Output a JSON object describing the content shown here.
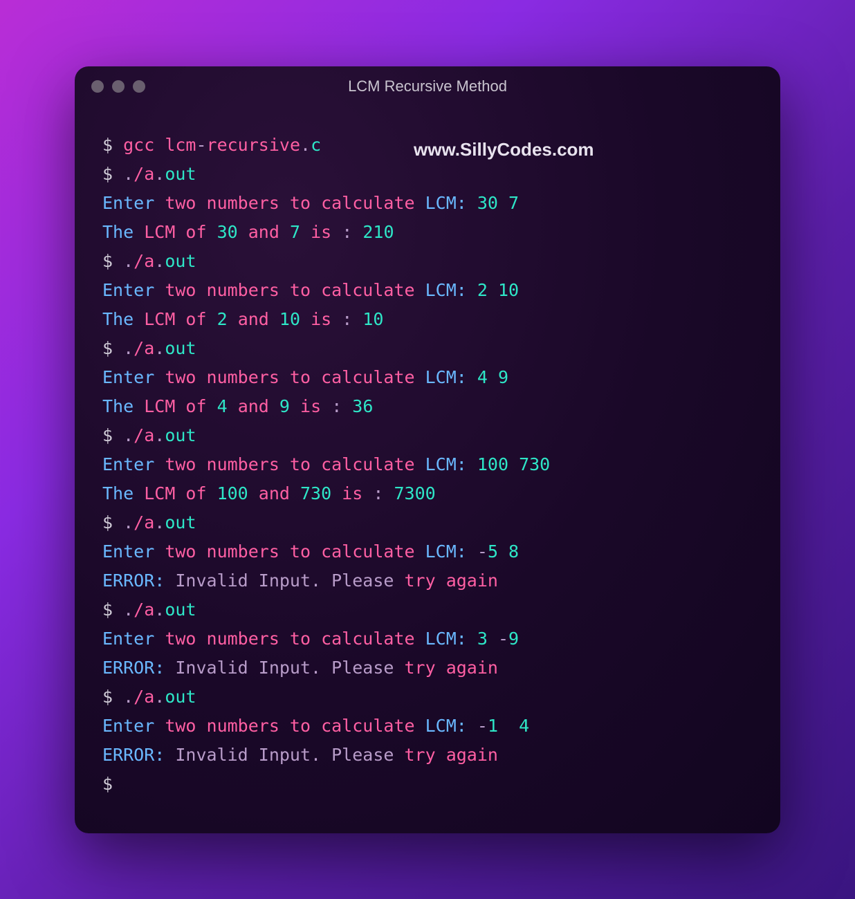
{
  "window": {
    "title": "LCM Recursive Method"
  },
  "watermark": "www.SillyCodes.com",
  "terminal": {
    "lines": [
      [
        {
          "t": "$ ",
          "c": "c-prompt"
        },
        {
          "t": "gcc lcm",
          "c": "c-pink"
        },
        {
          "t": "-",
          "c": "c-lav"
        },
        {
          "t": "recursive",
          "c": "c-pink"
        },
        {
          "t": ".",
          "c": "c-lav"
        },
        {
          "t": "c",
          "c": "c-teal"
        }
      ],
      [
        {
          "t": "$ ",
          "c": "c-prompt"
        },
        {
          "t": ".",
          "c": "c-lav"
        },
        {
          "t": "/a",
          "c": "c-pink"
        },
        {
          "t": ".",
          "c": "c-lav"
        },
        {
          "t": "out",
          "c": "c-teal"
        }
      ],
      [
        {
          "t": "Enter ",
          "c": "c-cyan"
        },
        {
          "t": "two numbers to calculate ",
          "c": "c-pink"
        },
        {
          "t": "LCM: ",
          "c": "c-cyan"
        },
        {
          "t": "30 7",
          "c": "c-teal"
        }
      ],
      [
        {
          "t": "The ",
          "c": "c-cyan"
        },
        {
          "t": "LCM of ",
          "c": "c-pink"
        },
        {
          "t": "30",
          "c": "c-teal"
        },
        {
          "t": " and ",
          "c": "c-pink"
        },
        {
          "t": "7",
          "c": "c-teal"
        },
        {
          "t": " is ",
          "c": "c-pink"
        },
        {
          "t": ": ",
          "c": "c-lav"
        },
        {
          "t": "210",
          "c": "c-teal"
        }
      ],
      [
        {
          "t": "$ ",
          "c": "c-prompt"
        },
        {
          "t": ".",
          "c": "c-lav"
        },
        {
          "t": "/a",
          "c": "c-pink"
        },
        {
          "t": ".",
          "c": "c-lav"
        },
        {
          "t": "out",
          "c": "c-teal"
        }
      ],
      [
        {
          "t": "Enter ",
          "c": "c-cyan"
        },
        {
          "t": "two numbers to calculate ",
          "c": "c-pink"
        },
        {
          "t": "LCM: ",
          "c": "c-cyan"
        },
        {
          "t": "2 10",
          "c": "c-teal"
        }
      ],
      [
        {
          "t": "The ",
          "c": "c-cyan"
        },
        {
          "t": "LCM of ",
          "c": "c-pink"
        },
        {
          "t": "2",
          "c": "c-teal"
        },
        {
          "t": " and ",
          "c": "c-pink"
        },
        {
          "t": "10",
          "c": "c-teal"
        },
        {
          "t": " is ",
          "c": "c-pink"
        },
        {
          "t": ": ",
          "c": "c-lav"
        },
        {
          "t": "10",
          "c": "c-teal"
        }
      ],
      [
        {
          "t": "$ ",
          "c": "c-prompt"
        },
        {
          "t": ".",
          "c": "c-lav"
        },
        {
          "t": "/a",
          "c": "c-pink"
        },
        {
          "t": ".",
          "c": "c-lav"
        },
        {
          "t": "out",
          "c": "c-teal"
        }
      ],
      [
        {
          "t": "Enter ",
          "c": "c-cyan"
        },
        {
          "t": "two numbers to calculate ",
          "c": "c-pink"
        },
        {
          "t": "LCM: ",
          "c": "c-cyan"
        },
        {
          "t": "4 9",
          "c": "c-teal"
        }
      ],
      [
        {
          "t": "The ",
          "c": "c-cyan"
        },
        {
          "t": "LCM of ",
          "c": "c-pink"
        },
        {
          "t": "4",
          "c": "c-teal"
        },
        {
          "t": " and ",
          "c": "c-pink"
        },
        {
          "t": "9",
          "c": "c-teal"
        },
        {
          "t": " is ",
          "c": "c-pink"
        },
        {
          "t": ": ",
          "c": "c-lav"
        },
        {
          "t": "36",
          "c": "c-teal"
        }
      ],
      [
        {
          "t": "$ ",
          "c": "c-prompt"
        },
        {
          "t": ".",
          "c": "c-lav"
        },
        {
          "t": "/a",
          "c": "c-pink"
        },
        {
          "t": ".",
          "c": "c-lav"
        },
        {
          "t": "out",
          "c": "c-teal"
        }
      ],
      [
        {
          "t": "Enter ",
          "c": "c-cyan"
        },
        {
          "t": "two numbers to calculate ",
          "c": "c-pink"
        },
        {
          "t": "LCM: ",
          "c": "c-cyan"
        },
        {
          "t": "100 730",
          "c": "c-teal"
        }
      ],
      [
        {
          "t": "The ",
          "c": "c-cyan"
        },
        {
          "t": "LCM of ",
          "c": "c-pink"
        },
        {
          "t": "100",
          "c": "c-teal"
        },
        {
          "t": " and ",
          "c": "c-pink"
        },
        {
          "t": "730",
          "c": "c-teal"
        },
        {
          "t": " is ",
          "c": "c-pink"
        },
        {
          "t": ": ",
          "c": "c-lav"
        },
        {
          "t": "7300",
          "c": "c-teal"
        }
      ],
      [
        {
          "t": "$ ",
          "c": "c-prompt"
        },
        {
          "t": ".",
          "c": "c-lav"
        },
        {
          "t": "/a",
          "c": "c-pink"
        },
        {
          "t": ".",
          "c": "c-lav"
        },
        {
          "t": "out",
          "c": "c-teal"
        }
      ],
      [
        {
          "t": "Enter ",
          "c": "c-cyan"
        },
        {
          "t": "two numbers to calculate ",
          "c": "c-pink"
        },
        {
          "t": "LCM: ",
          "c": "c-cyan"
        },
        {
          "t": "-",
          "c": "c-lav"
        },
        {
          "t": "5 8",
          "c": "c-teal"
        }
      ],
      [
        {
          "t": "ERROR: ",
          "c": "c-cyan"
        },
        {
          "t": "Invalid Input. Please ",
          "c": "c-lav"
        },
        {
          "t": "try again",
          "c": "c-pink"
        }
      ],
      [
        {
          "t": "$ ",
          "c": "c-prompt"
        },
        {
          "t": ".",
          "c": "c-lav"
        },
        {
          "t": "/a",
          "c": "c-pink"
        },
        {
          "t": ".",
          "c": "c-lav"
        },
        {
          "t": "out",
          "c": "c-teal"
        }
      ],
      [
        {
          "t": "Enter ",
          "c": "c-cyan"
        },
        {
          "t": "two numbers to calculate ",
          "c": "c-pink"
        },
        {
          "t": "LCM: ",
          "c": "c-cyan"
        },
        {
          "t": "3 ",
          "c": "c-teal"
        },
        {
          "t": "-",
          "c": "c-lav"
        },
        {
          "t": "9",
          "c": "c-teal"
        }
      ],
      [
        {
          "t": "ERROR: ",
          "c": "c-cyan"
        },
        {
          "t": "Invalid Input. Please ",
          "c": "c-lav"
        },
        {
          "t": "try again",
          "c": "c-pink"
        }
      ],
      [
        {
          "t": "$ ",
          "c": "c-prompt"
        },
        {
          "t": ".",
          "c": "c-lav"
        },
        {
          "t": "/a",
          "c": "c-pink"
        },
        {
          "t": ".",
          "c": "c-lav"
        },
        {
          "t": "out",
          "c": "c-teal"
        }
      ],
      [
        {
          "t": "Enter ",
          "c": "c-cyan"
        },
        {
          "t": "two numbers to calculate ",
          "c": "c-pink"
        },
        {
          "t": "LCM: ",
          "c": "c-cyan"
        },
        {
          "t": "-",
          "c": "c-lav"
        },
        {
          "t": "1  4",
          "c": "c-teal"
        }
      ],
      [
        {
          "t": "ERROR: ",
          "c": "c-cyan"
        },
        {
          "t": "Invalid Input. Please ",
          "c": "c-lav"
        },
        {
          "t": "try again",
          "c": "c-pink"
        }
      ],
      [
        {
          "t": "$ ",
          "c": "c-prompt"
        }
      ]
    ]
  }
}
